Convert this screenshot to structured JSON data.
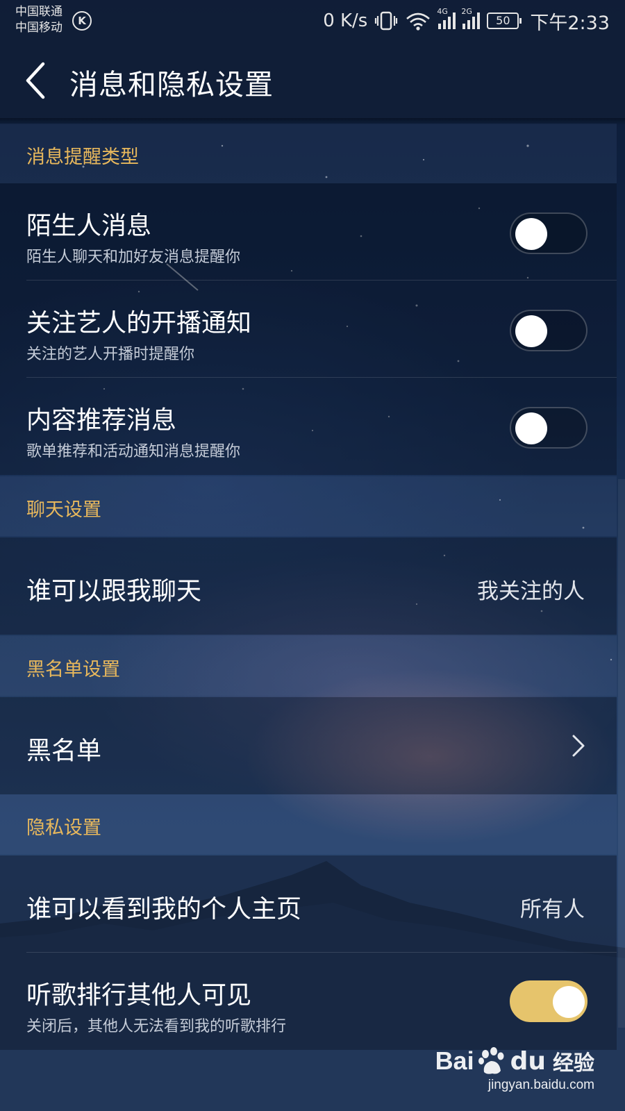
{
  "status_bar": {
    "carrier_1": "中国联通",
    "carrier_2": "中国移动",
    "carrier_badge": "K",
    "net_speed": "0 K/s",
    "signal_1_tag": "4G",
    "signal_2_tag": "2G",
    "battery": "50",
    "time": "下午2:33"
  },
  "header": {
    "title": "消息和隐私设置"
  },
  "sections": {
    "notify": {
      "header": "消息提醒类型",
      "stranger": {
        "title": "陌生人消息",
        "subtitle": "陌生人聊天和加好友消息提醒你",
        "enabled": false
      },
      "artist_live": {
        "title": "关注艺人的开播通知",
        "subtitle": "关注的艺人开播时提醒你",
        "enabled": false
      },
      "recommend": {
        "title": "内容推荐消息",
        "subtitle": "歌单推荐和活动通知消息提醒你",
        "enabled": false
      }
    },
    "chat": {
      "header": "聊天设置",
      "who_can_chat": {
        "title": "谁可以跟我聊天",
        "value": "我关注的人"
      }
    },
    "blacklist": {
      "header": "黑名单设置",
      "blacklist": {
        "title": "黑名单"
      }
    },
    "privacy": {
      "header": "隐私设置",
      "homepage": {
        "title": "谁可以看到我的个人主页",
        "value": "所有人"
      },
      "ranking": {
        "title": "听歌排行其他人可见",
        "subtitle": "关闭后，其他人无法看到我的听歌排行",
        "enabled": true
      }
    }
  },
  "watermark": {
    "brand_bai": "Bai",
    "brand_du": "du",
    "brand_jingyan": "经验",
    "url": "jingyan.baidu.com"
  },
  "colors": {
    "section_header": "#e8b85c",
    "toggle_on": "#e6c46c",
    "background": "#13284a"
  },
  "icons": [
    "back-arrow-icon",
    "vibrate-icon",
    "wifi-icon",
    "signal-icon",
    "battery-icon",
    "chevron-right-icon",
    "baidu-paw-icon"
  ]
}
